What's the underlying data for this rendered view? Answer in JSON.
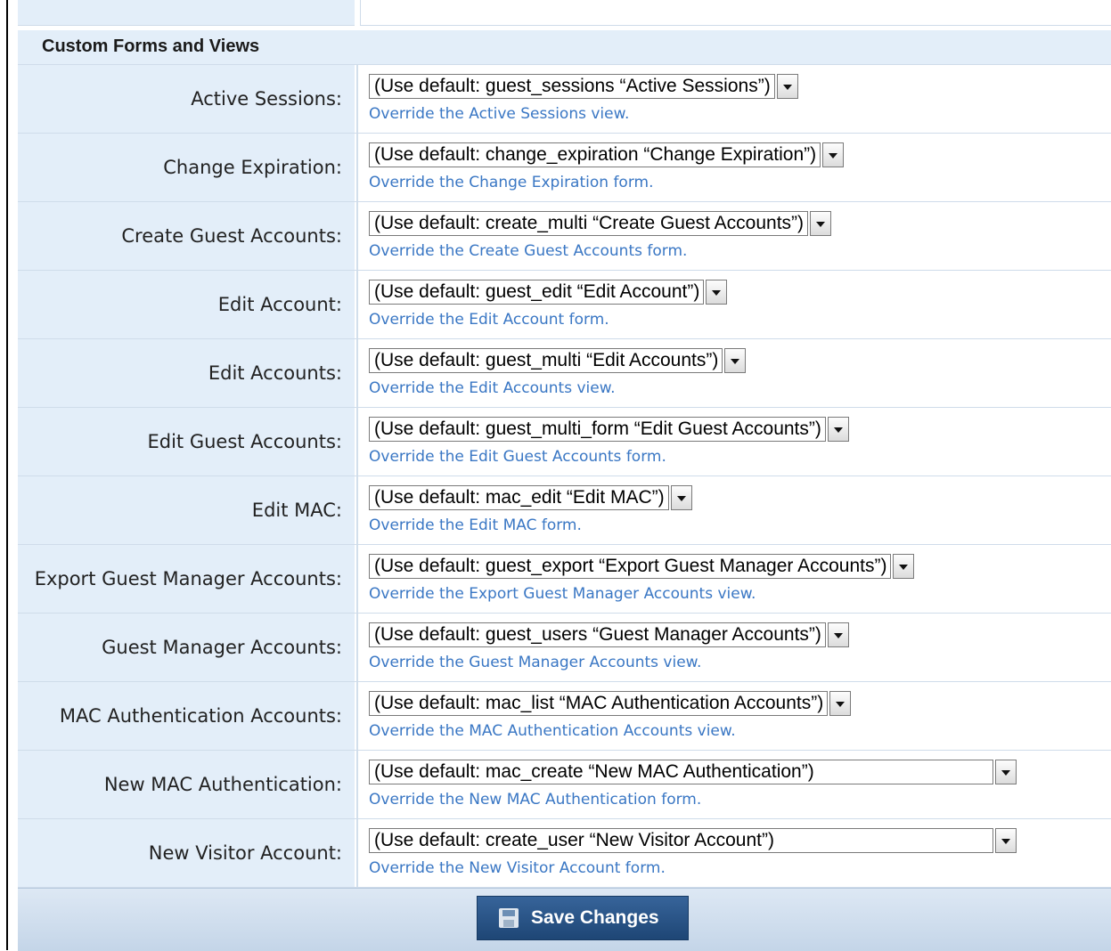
{
  "section": {
    "title": "Custom Forms and Views"
  },
  "rows": [
    {
      "label": "Active Sessions:",
      "select": "(Use default: guest_sessions “Active Sessions”)",
      "override": "Override the Active Sessions view."
    },
    {
      "label": "Change Expiration:",
      "select": "(Use default: change_expiration “Change Expiration”)",
      "override": "Override the Change Expiration form."
    },
    {
      "label": "Create Guest Accounts:",
      "select": "(Use default: create_multi “Create Guest Accounts”)",
      "override": "Override the Create Guest Accounts form."
    },
    {
      "label": "Edit Account:",
      "select": "(Use default: guest_edit “Edit Account”)",
      "override": "Override the Edit Account form."
    },
    {
      "label": "Edit Accounts:",
      "select": "(Use default: guest_multi “Edit Accounts”)",
      "override": "Override the Edit Accounts view."
    },
    {
      "label": "Edit Guest Accounts:",
      "select": "(Use default: guest_multi_form “Edit Guest Accounts”)",
      "override": "Override the Edit Guest Accounts form."
    },
    {
      "label": "Edit MAC:",
      "select": "(Use default: mac_edit “Edit MAC”)",
      "override": "Override the Edit MAC form."
    },
    {
      "label": "Export Guest Manager Accounts:",
      "select": "(Use default: guest_export “Export Guest Manager Accounts”)",
      "override": "Override the Export Guest Manager Accounts view."
    },
    {
      "label": "Guest Manager Accounts:",
      "select": "(Use default: guest_users “Guest Manager Accounts”)",
      "override": "Override the Guest Manager Accounts view."
    },
    {
      "label": "MAC Authentication Accounts:",
      "select": "(Use default: mac_list “MAC Authentication Accounts”)",
      "override": "Override the MAC Authentication Accounts view."
    },
    {
      "label": "New MAC Authentication:",
      "select": "(Use default: mac_create “New MAC Authentication”)",
      "override": "Override the New MAC Authentication form."
    },
    {
      "label": "New Visitor Account:",
      "select": "(Use default: create_user “New Visitor Account”)",
      "override": "Override the New Visitor Account form."
    }
  ],
  "footer": {
    "save_label": "Save Changes"
  },
  "icons": {
    "save": "floppy-disk-icon",
    "dropdown": "chevron-down-icon"
  }
}
